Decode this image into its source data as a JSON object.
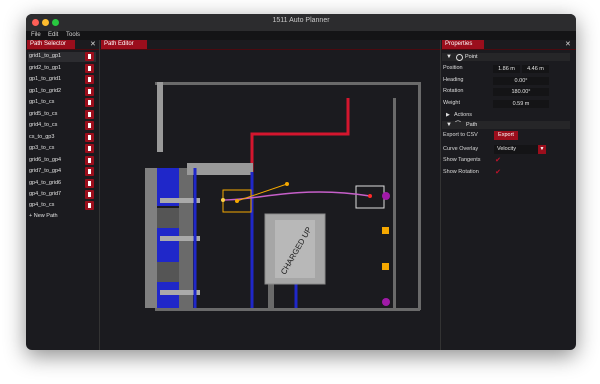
{
  "window": {
    "title": "1511 Auto Planner"
  },
  "menu": [
    "File",
    "Edit",
    "Tools"
  ],
  "path_selector": {
    "title": "Path Selector",
    "close": "✕",
    "paths": [
      "grid1_to_gp1",
      "grid2_to_gp1",
      "gp1_to_grid1",
      "gp1_to_grid2",
      "gp1_to_cs",
      "grid5_to_cs",
      "grid4_to_cs",
      "cs_to_gp3",
      "gp3_to_cs",
      "grid6_to_gp4",
      "grid7_to_gp4",
      "gp4_to_grid6",
      "gp4_to_grid7",
      "gp4_to_cs"
    ],
    "new_path": "+ New Path"
  },
  "path_editor": {
    "title": "Path Editor",
    "logo_text": "CHARGED UP"
  },
  "properties": {
    "title": "Properties",
    "close": "✕",
    "point_header": "Point",
    "position_label": "Position",
    "position_x": "1.86 m",
    "position_y": "4.46 m",
    "heading_label": "Heading",
    "heading_value": "0.00°",
    "rotation_label": "Rotation",
    "rotation_value": "180.00°",
    "weight_label": "Weight",
    "weight_value": "0.59 m",
    "actions_label": "Actions",
    "path_header": "Path",
    "export_label": "Export to CSV",
    "export_button": "Export",
    "curve_overlay_label": "Curve Overlay",
    "curve_overlay_value": "Velocity",
    "show_tangents_label": "Show Tangents",
    "show_rotation_label": "Show Rotation"
  },
  "colors": {
    "accent": "#9b0e1c",
    "field_blue": "#1f27c9",
    "path_line": "#d4162e",
    "cone_orange": "#f5a800",
    "cube_purple": "#a01aa8"
  }
}
